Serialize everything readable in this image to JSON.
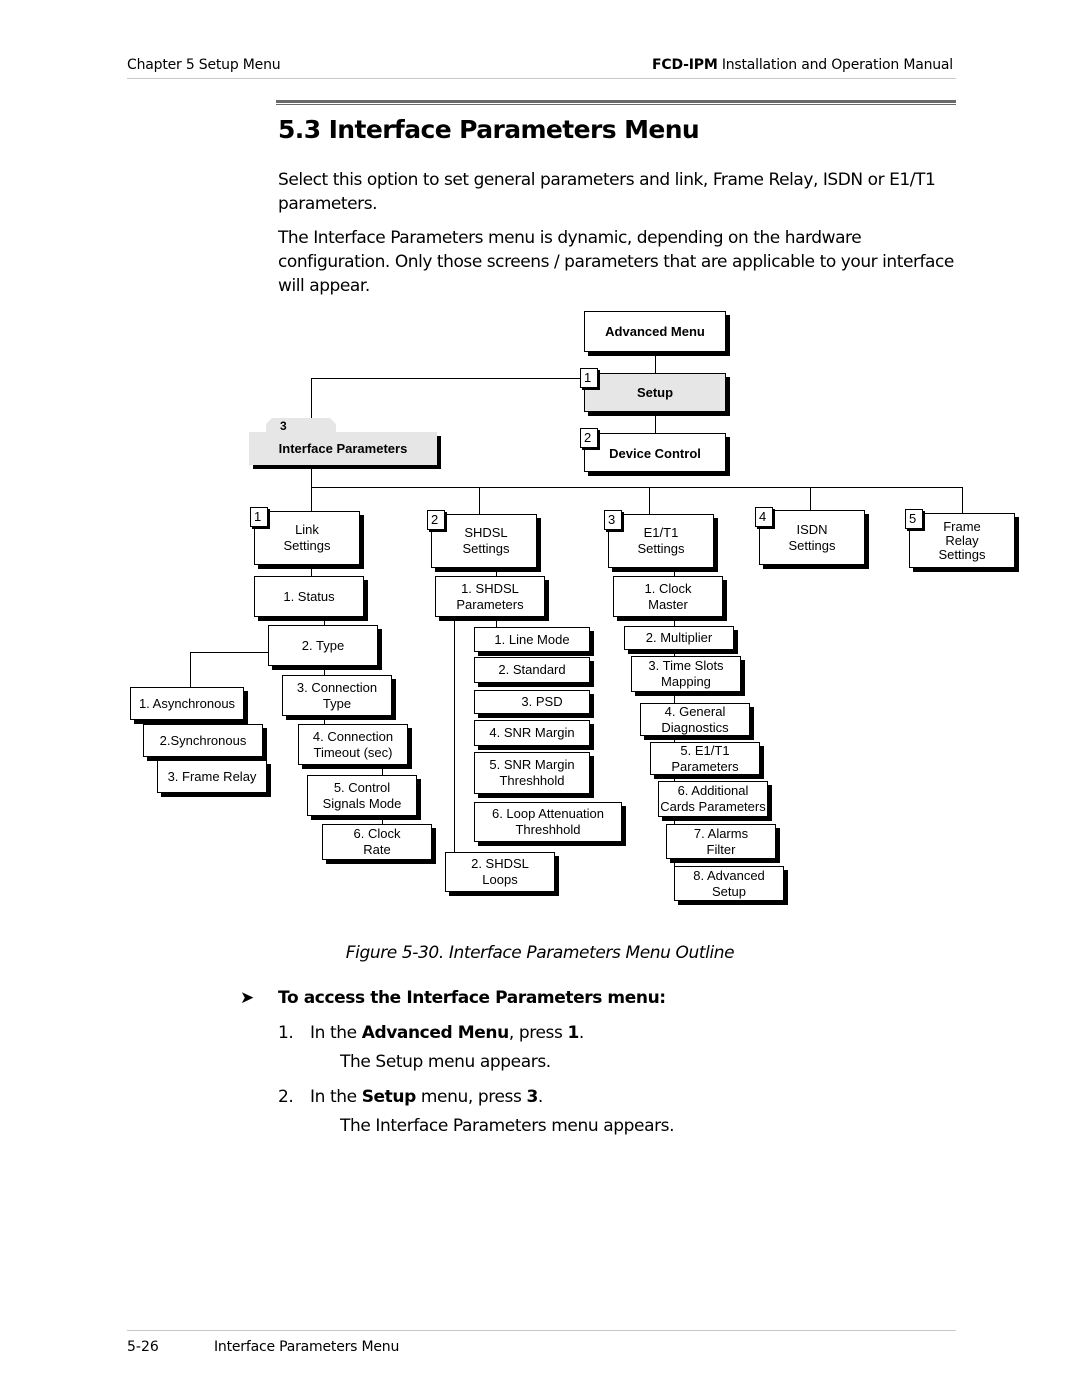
{
  "header": {
    "chapter": "Chapter 5  Setup Menu",
    "manual_bold": "FCD-IPM",
    "manual_rest": " Installation and Operation Manual"
  },
  "section": {
    "title": "5.3  Interface Parameters Menu",
    "para1": "Select this option to set general parameters and link, Frame Relay, ISDN or E1/T1 parameters.",
    "para2": "The Interface Parameters menu is dynamic, depending on the hardware configuration. Only those screens / parameters that are applicable to your interface will appear."
  },
  "diagram": {
    "advanced_menu": "Advanced Menu",
    "setup": {
      "num": "1",
      "label": "Setup"
    },
    "device_control": {
      "num": "2",
      "label": "Device Control"
    },
    "interface_parameters": {
      "num": "3",
      "label": "Interface Parameters"
    },
    "link": {
      "num": "1",
      "label": "Link\nSettings",
      "status": "1. Status",
      "type": "2. Type",
      "type_options": [
        "1. Asynchronous",
        "2.Synchronous",
        "3. Frame Relay"
      ],
      "connection_type": "3. Connection\nType",
      "connection_timeout": "4. Connection\nTimeout (sec)",
      "control_signals": "5. Control\nSignals Mode",
      "clock_rate": "6. Clock\nRate"
    },
    "shdsl": {
      "num": "2",
      "label": "SHDSL\nSettings",
      "parameters": "1. SHDSL\nParameters",
      "param_items": [
        "1. Line Mode",
        "2. Standard",
        "3. PSD",
        "4. SNR Margin",
        "5. SNR Margin\nThreshhold",
        "6. Loop Attenuation\nThreshhold"
      ],
      "loops": "2. SHDSL\nLoops"
    },
    "e1t1": {
      "num": "3",
      "label": "E1/T1\nSettings",
      "items": [
        "1. Clock\nMaster",
        "2. Multiplier",
        "3. Time Slots\nMapping",
        "4. General\nDiagnostics",
        "5. E1/T1\nParameters",
        "6. Additional\nCards Parameters",
        "7. Alarms\nFilter",
        "8. Advanced\nSetup"
      ]
    },
    "isdn": {
      "num": "4",
      "label": "ISDN\nSettings"
    },
    "frame_relay": {
      "num": "5",
      "label": "Frame\nRelay\nSettings"
    }
  },
  "figure_caption": "Figure 5-30.  Interface Parameters Menu Outline",
  "procedure": {
    "arrow": "➤",
    "title": "To access the Interface Parameters menu:",
    "steps": [
      {
        "n": "1.",
        "pre": "In the ",
        "bold": "Advanced Menu",
        "mid": ", press ",
        "key": "1",
        "post": ".",
        "result": "The Setup menu appears."
      },
      {
        "n": "2.",
        "pre": "In the ",
        "bold": "Setup",
        "mid": " menu, press ",
        "key": "3",
        "post": ".",
        "result": "The Interface Parameters menu appears."
      }
    ]
  },
  "footer": {
    "page": "5-26",
    "title": "Interface Parameters Menu"
  }
}
